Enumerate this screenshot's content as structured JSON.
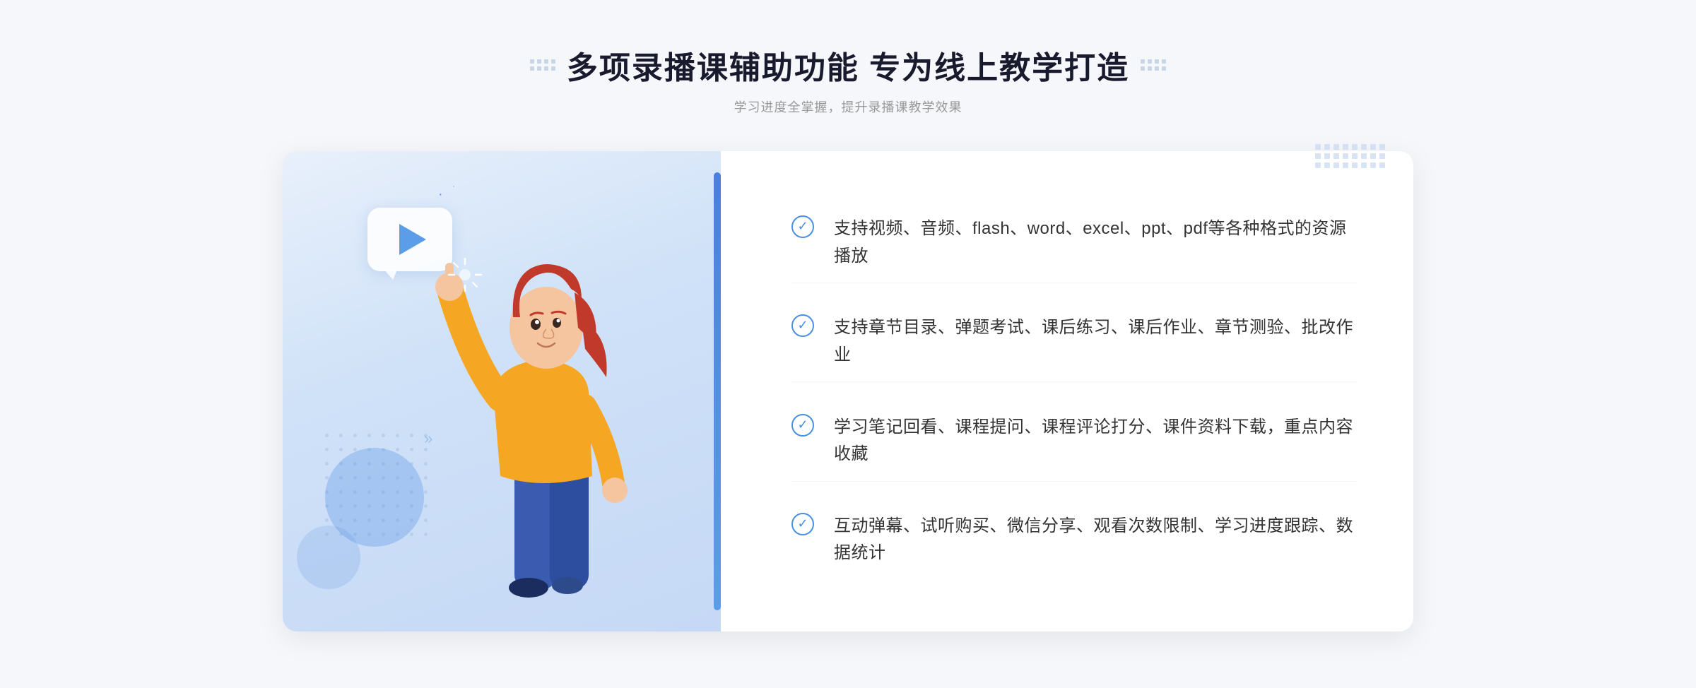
{
  "header": {
    "title": "多项录播课辅助功能 专为线上教学打造",
    "subtitle": "学习进度全掌握，提升录播课教学效果",
    "dots_left": "dots-decoration-left",
    "dots_right": "dots-decoration-right"
  },
  "features": [
    {
      "id": "feature-1",
      "text": "支持视频、音频、flash、word、excel、ppt、pdf等各种格式的资源播放"
    },
    {
      "id": "feature-2",
      "text": "支持章节目录、弹题考试、课后练习、课后作业、章节测验、批改作业"
    },
    {
      "id": "feature-3",
      "text": "学习笔记回看、课程提问、课程评论打分、课件资料下载，重点内容收藏"
    },
    {
      "id": "feature-4",
      "text": "互动弹幕、试听购买、微信分享、观看次数限制、学习进度跟踪、数据统计"
    }
  ],
  "illustration": {
    "play_button_aria": "play-button",
    "person_aria": "person-pointing-up"
  },
  "colors": {
    "primary_blue": "#4a90e2",
    "light_blue": "#5b9de8",
    "bg": "#f5f7fa",
    "card_bg": "#ffffff",
    "text_dark": "#1a1a2e",
    "text_gray": "#999999",
    "text_body": "#333333"
  }
}
